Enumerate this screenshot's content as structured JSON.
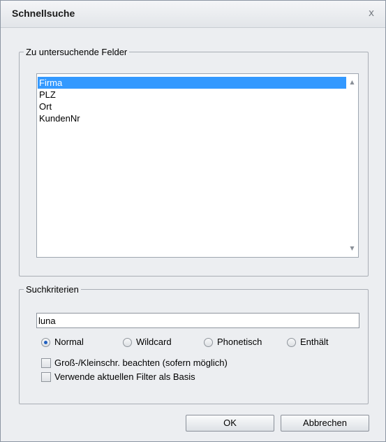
{
  "dialog": {
    "title": "Schnellsuche",
    "close_icon": "close-icon",
    "close_glyph": "x"
  },
  "fields_group": {
    "legend": "Zu untersuchende Felder",
    "items": [
      "Firma",
      "PLZ",
      "Ort",
      "KundenNr"
    ],
    "selected": "Firma",
    "scroll_up_glyph": "▲",
    "scroll_down_glyph": "▼"
  },
  "criteria_group": {
    "legend": "Suchkriterien",
    "search_value": "luna",
    "radios": [
      {
        "label": "Normal",
        "checked": true
      },
      {
        "label": "Wildcard",
        "checked": false
      },
      {
        "label": "Phonetisch",
        "checked": false
      },
      {
        "label": "Enthält",
        "checked": false
      }
    ],
    "checkboxes": [
      {
        "label": "Groß-/Kleinschr. beachten (sofern möglich)",
        "checked": false
      },
      {
        "label": "Verwende aktuellen Filter als Basis",
        "checked": false
      }
    ]
  },
  "buttons": {
    "ok": "OK",
    "cancel": "Abbrechen"
  },
  "colors": {
    "selection": "#3399ff",
    "radio_accent": "#2060c0"
  }
}
